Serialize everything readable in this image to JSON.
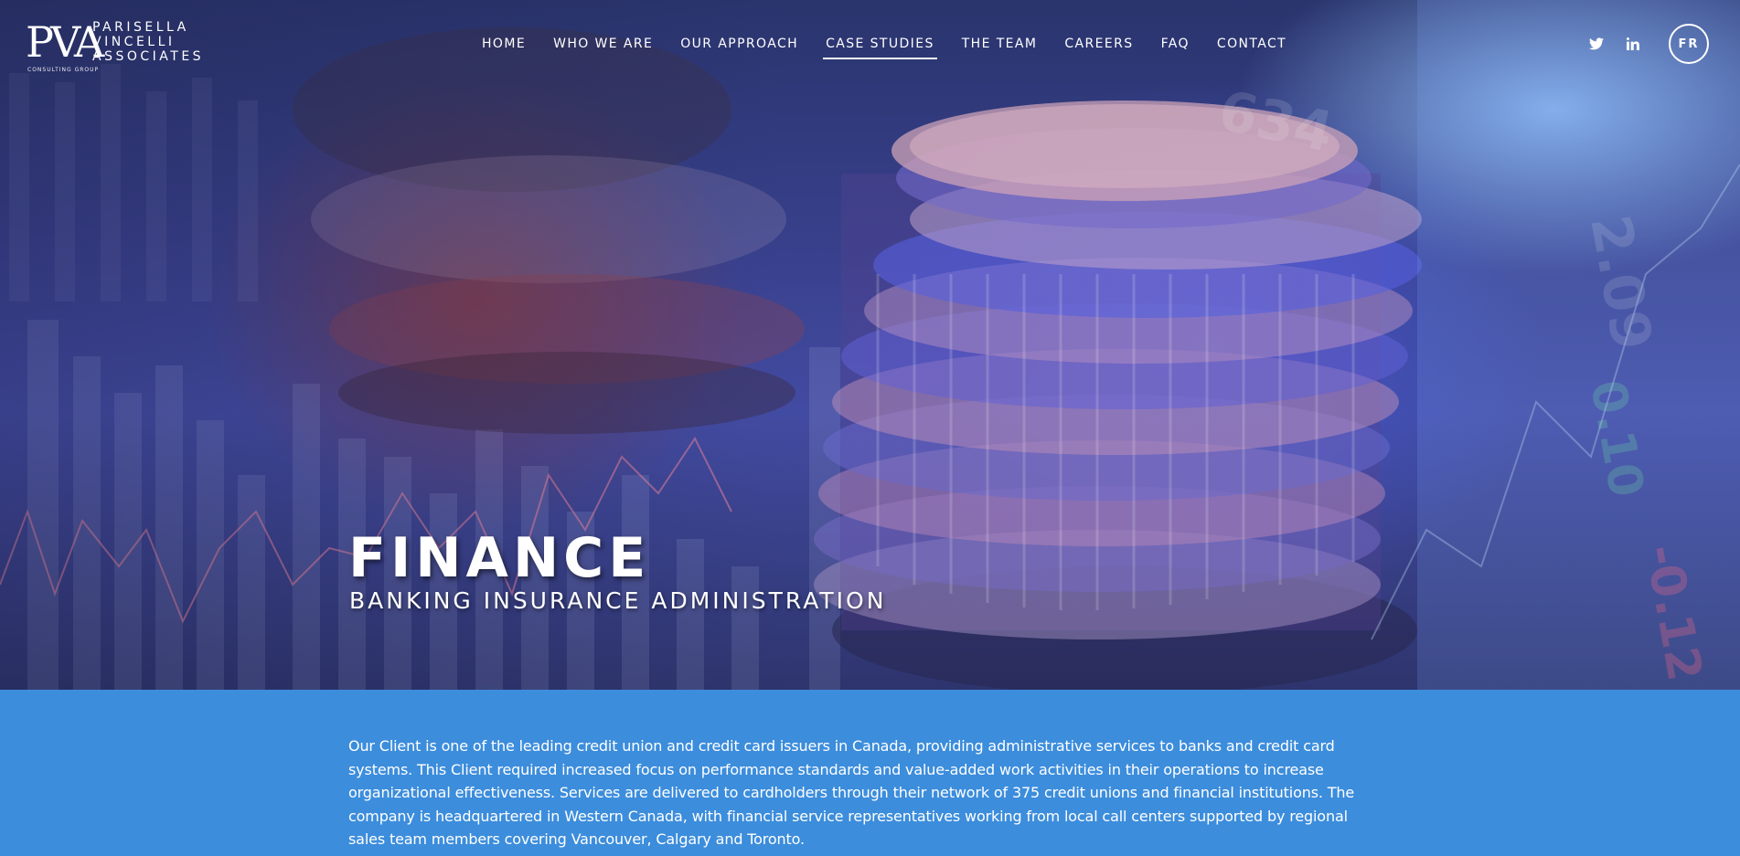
{
  "logo": {
    "mark": "PVA",
    "line1": "PARISELLA",
    "line2": "VINCELLI",
    "line3": "ASSOCIATES",
    "tagline": "CONSULTING GROUP"
  },
  "nav": {
    "items": [
      {
        "label": "HOME"
      },
      {
        "label": "WHO WE ARE"
      },
      {
        "label": "OUR APPROACH"
      },
      {
        "label": "CASE STUDIES",
        "active": true
      },
      {
        "label": "THE TEAM"
      },
      {
        "label": "CAREERS"
      },
      {
        "label": "FAQ"
      },
      {
        "label": "CONTACT"
      }
    ]
  },
  "social": {
    "twitter_icon": "twitter-icon",
    "linkedin_icon": "linkedin-icon",
    "lang_label": "FR"
  },
  "hero": {
    "title": "FINANCE",
    "subtitle": "BANKING INSURANCE ADMINISTRATION"
  },
  "content": {
    "intro": "Our Client is one of the leading credit union and credit card issuers in Canada, providing administrative services to banks and credit card systems. This Client required increased focus on performance standards and value-added work activities in their operations to increase organizational effectiveness. Services are delivered to cardholders through their network of 375 credit unions and financial institutions. The company is headquartered in Western Canada, with financial service representatives working from local call centers supported by regional sales team members covering Vancouver, Calgary and Toronto."
  },
  "colors": {
    "content_bg": "#3c8ddc",
    "text": "#ffffff"
  }
}
